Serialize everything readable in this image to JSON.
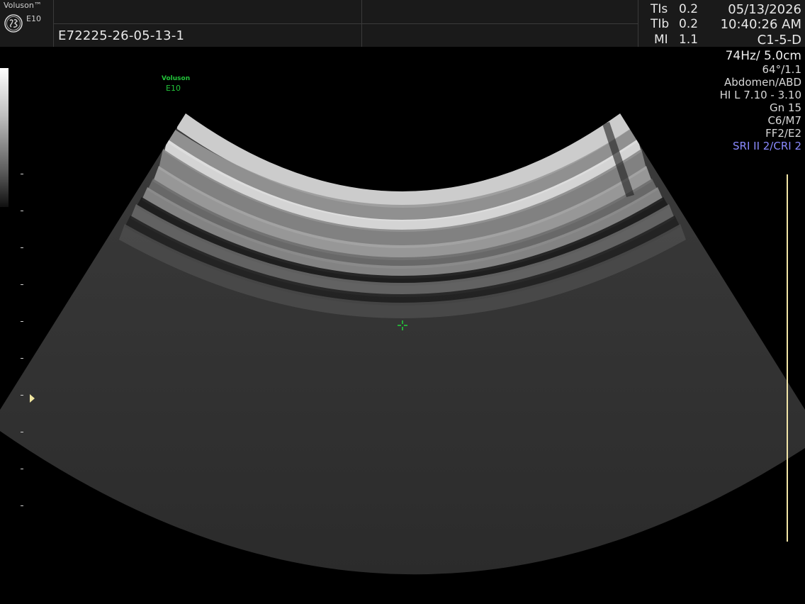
{
  "header": {
    "brand_name": "Voluson™",
    "brand_model": "E10",
    "patient_id": "E72225-26-05-13-1",
    "date": "05/13/2026",
    "time": "10:40:26 AM",
    "probe": "C1-5-D"
  },
  "thermal": {
    "tis_label": "TIs",
    "tis_value": "0.2",
    "tib_label": "TIb",
    "tib_value": "0.2",
    "mi_label": "MI",
    "mi_value": "1.1"
  },
  "imaging_params": {
    "freq_depth": "74Hz/ 5.0cm",
    "angle": "64°/1.1",
    "preset": "Abdomen/ABD",
    "harmonic": "HI L  7.10 - 3.10",
    "gain": "Gn  15",
    "contrast_map": "C6/M7",
    "filter": "FF2/E2",
    "sri_cri": "SRI II 2/CRI 2"
  },
  "image": {
    "watermark_name": "Voluson",
    "watermark_model": "E10"
  },
  "colors": {
    "header_bg": "#1a1a1a",
    "watermark": "#22c43a",
    "sri_text": "#8a8aff",
    "scale_line": "#f3e6a8"
  },
  "icons": {
    "logo": "ge-logo-icon",
    "focus": "focus-marker-icon",
    "caliper": "caliper-crosshair-icon"
  }
}
